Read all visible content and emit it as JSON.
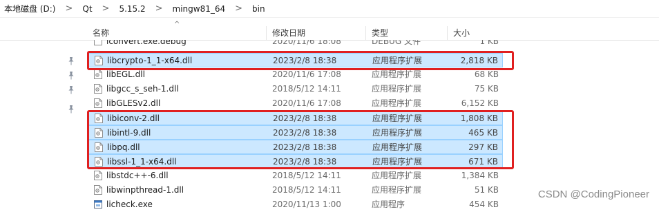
{
  "breadcrumb": [
    "本地磁盘 (D:)",
    "Qt",
    "5.15.2",
    "mingw81_64",
    "bin"
  ],
  "breadcrumb_separator": ">",
  "columns": {
    "name": "名称",
    "date": "修改日期",
    "type": "类型",
    "size": "大小"
  },
  "sort_indicator": "^",
  "files": [
    {
      "name": "lconvert.exe.debug",
      "date": "2020/11/6 18:08",
      "type": "DEBUG 文件",
      "size": "1 KB",
      "icon": "file-icon",
      "selected": false
    },
    {
      "name": "libcrypto-1_1-x64.dll",
      "date": "2023/2/8 18:38",
      "type": "应用程序扩展",
      "size": "2,818 KB",
      "icon": "dll-icon",
      "selected": true
    },
    {
      "name": "libEGL.dll",
      "date": "2020/11/6 17:08",
      "type": "应用程序扩展",
      "size": "68 KB",
      "icon": "dll-icon",
      "selected": false
    },
    {
      "name": "libgcc_s_seh-1.dll",
      "date": "2018/5/12 14:11",
      "type": "应用程序扩展",
      "size": "75 KB",
      "icon": "dll-icon",
      "selected": false
    },
    {
      "name": "libGLESv2.dll",
      "date": "2020/11/6 17:08",
      "type": "应用程序扩展",
      "size": "6,152 KB",
      "icon": "dll-icon",
      "selected": false
    },
    {
      "name": "libiconv-2.dll",
      "date": "2023/2/8 18:38",
      "type": "应用程序扩展",
      "size": "1,808 KB",
      "icon": "dll-icon",
      "selected": true
    },
    {
      "name": "libintl-9.dll",
      "date": "2023/2/8 18:38",
      "type": "应用程序扩展",
      "size": "465 KB",
      "icon": "dll-icon",
      "selected": true
    },
    {
      "name": "libpq.dll",
      "date": "2023/2/8 18:38",
      "type": "应用程序扩展",
      "size": "297 KB",
      "icon": "dll-icon",
      "selected": true
    },
    {
      "name": "libssl-1_1-x64.dll",
      "date": "2023/2/8 18:38",
      "type": "应用程序扩展",
      "size": "671 KB",
      "icon": "dll-icon",
      "selected": true
    },
    {
      "name": "libstdc++-6.dll",
      "date": "2018/5/12 14:11",
      "type": "应用程序扩展",
      "size": "1,384 KB",
      "icon": "dll-icon",
      "selected": false
    },
    {
      "name": "libwinpthread-1.dll",
      "date": "2018/5/12 14:11",
      "type": "应用程序扩展",
      "size": "51 KB",
      "icon": "dll-icon",
      "selected": false
    },
    {
      "name": "licheck.exe",
      "date": "2020/11/13 1:00",
      "type": "应用程序",
      "size": "454 KB",
      "icon": "exe-icon",
      "selected": false
    }
  ],
  "pinned_icons": [
    "pin-icon",
    "pin-icon",
    "pin-icon",
    "pin-icon"
  ],
  "watermark": "CSDN @CodingPioneer",
  "colors": {
    "selection": "#cce8ff",
    "selection_border": "#99d1ff",
    "highlight_box": "#e02020"
  }
}
